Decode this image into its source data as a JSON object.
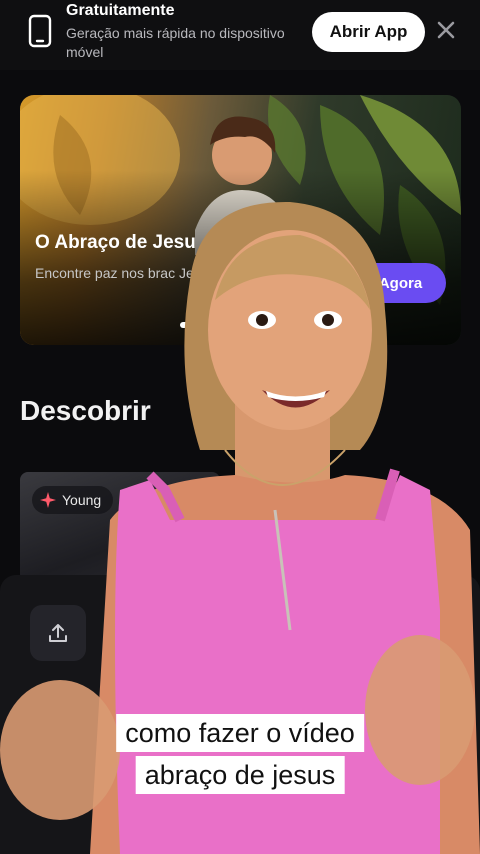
{
  "banner": {
    "title": "Gratuitamente",
    "subtitle": "Geração mais rápida no dispositivo móvel",
    "open_app_label": "Abrir App",
    "icon": "phone-icon",
    "close_icon": "close-icon"
  },
  "hero": {
    "title": "O Abraço de Jesu",
    "description": "Encontre paz nos brac Jesus.",
    "cta_label": "Agora",
    "carousel_active": 1,
    "accent": "#6a4cf2"
  },
  "discover": {
    "title": "Descobrir",
    "card_tag": "Young",
    "card_tag_icon": "sparkle-icon"
  },
  "panel": {
    "upload_icon": "upload-icon"
  },
  "captions": {
    "line1": "como  fazer o vídeo",
    "line2": "abraço de jesus"
  }
}
